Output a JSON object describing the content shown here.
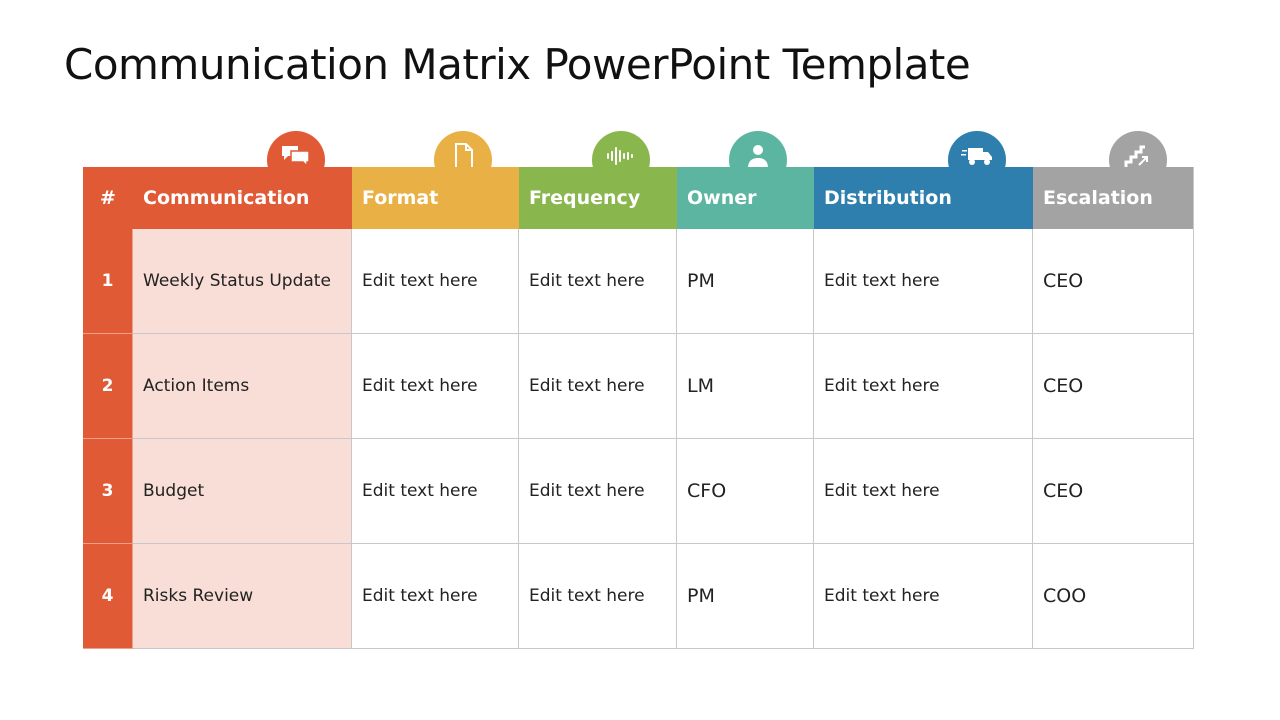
{
  "title": "Communication Matrix PowerPoint Template",
  "columns": [
    {
      "key": "num",
      "label": "#",
      "color": "#e05a35",
      "icon": null
    },
    {
      "key": "communication",
      "label": "Communication",
      "color": "#e05a35",
      "icon": "chat-bubbles-icon"
    },
    {
      "key": "format",
      "label": "Format",
      "color": "#e9b046",
      "icon": "document-icon"
    },
    {
      "key": "frequency",
      "label": "Frequency",
      "color": "#8ab64e",
      "icon": "soundwave-icon"
    },
    {
      "key": "owner",
      "label": "Owner",
      "color": "#5cb5a1",
      "icon": "person-icon"
    },
    {
      "key": "distribution",
      "label": "Distribution",
      "color": "#2e7fad",
      "icon": "delivery-truck-icon"
    },
    {
      "key": "escalation",
      "label": "Escalation",
      "color": "#a3a3a3",
      "icon": "stairs-arrow-icon"
    }
  ],
  "rows": [
    {
      "num": "1",
      "communication": "Weekly Status Update",
      "format": "Edit text here",
      "frequency": "Edit text here",
      "owner": "PM",
      "distribution": "Edit text here",
      "escalation": "CEO"
    },
    {
      "num": "2",
      "communication": "Action Items",
      "format": "Edit text here",
      "frequency": "Edit text here",
      "owner": "LM",
      "distribution": "Edit text here",
      "escalation": "CEO"
    },
    {
      "num": "3",
      "communication": "Budget",
      "format": "Edit text here",
      "frequency": "Edit text here",
      "owner": "CFO",
      "distribution": "Edit text here",
      "escalation": "CEO"
    },
    {
      "num": "4",
      "communication": "Risks Review",
      "format": "Edit text here",
      "frequency": "Edit text here",
      "owner": "PM",
      "distribution": "Edit text here",
      "escalation": "COO"
    }
  ]
}
